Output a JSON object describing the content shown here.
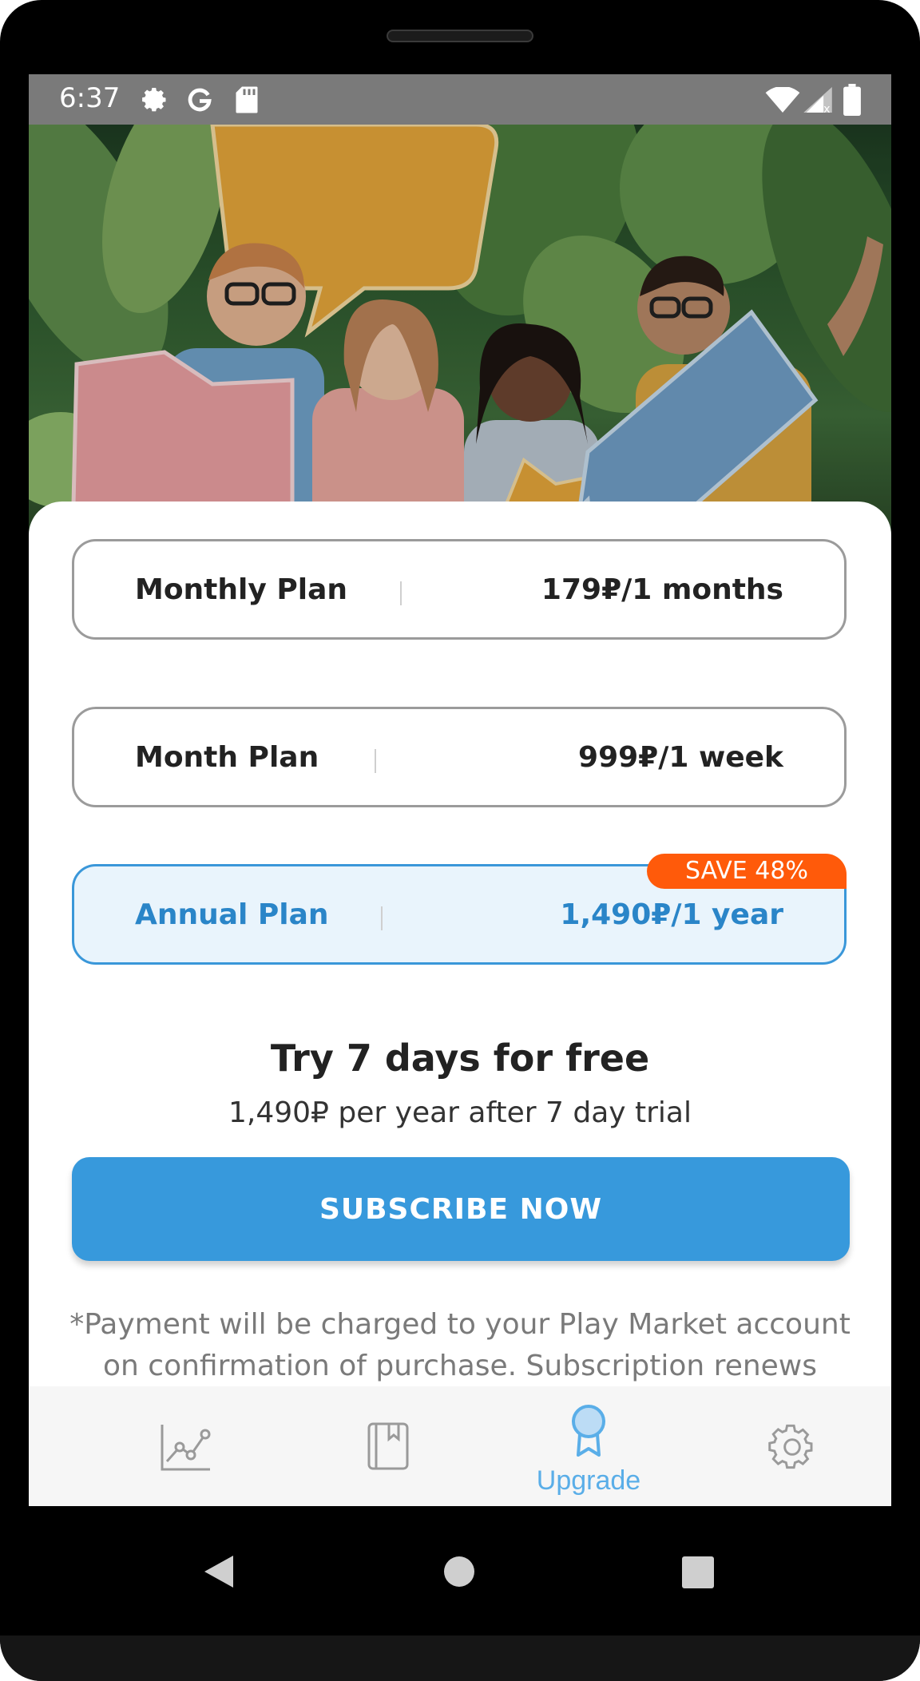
{
  "status_bar": {
    "time": "6:37",
    "left_icons": [
      "gear-icon",
      "google-g-icon",
      "sd-card-icon"
    ],
    "right_icons": [
      "wifi-icon",
      "cell-signal-icon",
      "battery-icon"
    ]
  },
  "hero": {
    "image": "photo of four smiling people holding speech bubble cards in front of tropical plants"
  },
  "plans": [
    {
      "name": "Monthly Plan",
      "price": "179₽/1 months",
      "selected": false
    },
    {
      "name": "Month Plan",
      "price": "999₽/1 week",
      "selected": false
    },
    {
      "name": "Annual Plan",
      "price": "1,490₽/1 year",
      "selected": true,
      "badge": "SAVE 48%"
    }
  ],
  "trial": {
    "title": "Try 7 days for free",
    "subtitle": "1,490₽ per year after 7 day trial"
  },
  "subscribe_button": "SUBSCRIBE NOW",
  "fine_print": "*Payment will be charged to your Play Market account on confirmation of purchase. Subscription renews",
  "bottom_nav": {
    "items": [
      {
        "icon": "chart-icon",
        "label": "",
        "active": false
      },
      {
        "icon": "book-icon",
        "label": "",
        "active": false
      },
      {
        "icon": "award-ribbon-icon",
        "label": "Upgrade",
        "active": true
      },
      {
        "icon": "gear-icon",
        "label": "",
        "active": false
      }
    ]
  },
  "colors": {
    "accent": "#3799dc",
    "badge": "#ff5a0a",
    "selected_bg": "#e9f4fc",
    "status_bar": "#7a7a7a"
  }
}
